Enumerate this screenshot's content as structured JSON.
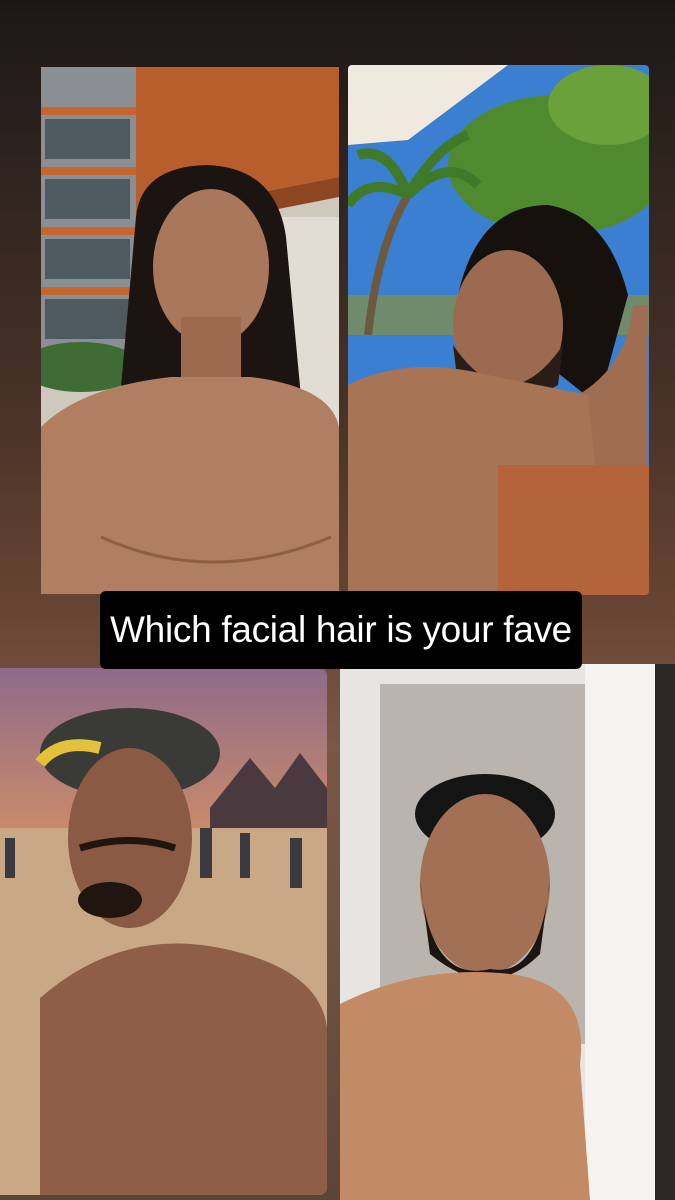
{
  "story": {
    "caption": "Which facial hair is your fave",
    "photos": [
      {
        "name": "photo-long-wavy-hair-balcony"
      },
      {
        "name": "photo-long-hair-beard-palm-trees"
      },
      {
        "name": "photo-headwrap-goatee-beach-sunset"
      },
      {
        "name": "photo-cap-full-beard-doorway"
      }
    ]
  }
}
